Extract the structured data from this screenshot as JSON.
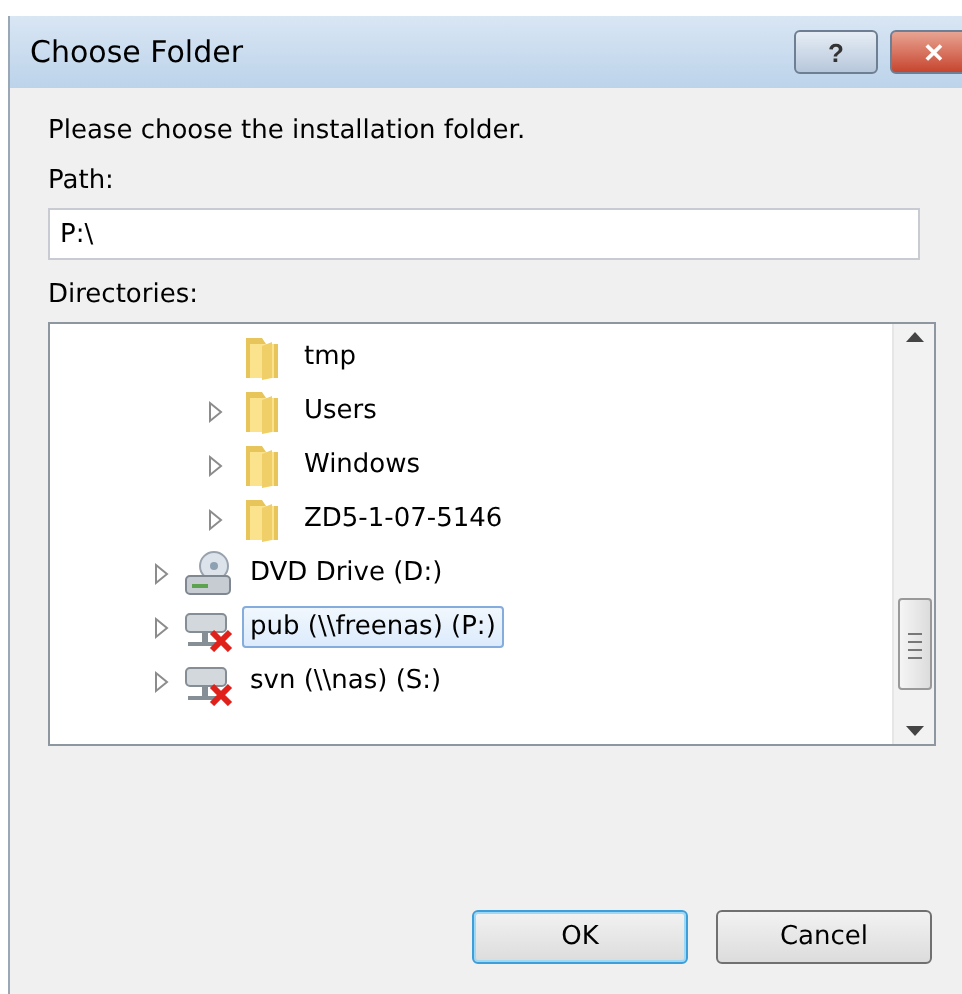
{
  "window": {
    "title": "Choose Folder",
    "buttons": [
      "?",
      "✕"
    ]
  },
  "prompt": "Please choose the installation folder.",
  "path": {
    "label": "Path:",
    "value": "P:\\"
  },
  "directories": {
    "label": "Directories:",
    "tree": [
      {
        "children": [
          {
            "label": "tmp",
            "kind": "folder",
            "expandable": false,
            "selected": false
          },
          {
            "label": "Users",
            "kind": "folder",
            "expandable": true,
            "selected": false
          },
          {
            "label": "Windows",
            "kind": "folder",
            "expandable": true,
            "selected": false
          },
          {
            "label": "ZD5-1-07-5146",
            "kind": "folder",
            "expandable": true,
            "selected": false
          }
        ]
      },
      {
        "label": "DVD Drive (D:)",
        "kind": "dvd",
        "expandable": true,
        "selected": false
      },
      {
        "label": "pub (\\\\freenas) (P:)",
        "kind": "network",
        "expandable": true,
        "selected": true
      },
      {
        "label": "svn (\\\\nas) (S:)",
        "kind": "network",
        "expandable": true,
        "selected": false
      }
    ]
  },
  "buttons": [
    {
      "label": "OK",
      "default": true
    },
    {
      "label": "Cancel",
      "default": false
    }
  ]
}
